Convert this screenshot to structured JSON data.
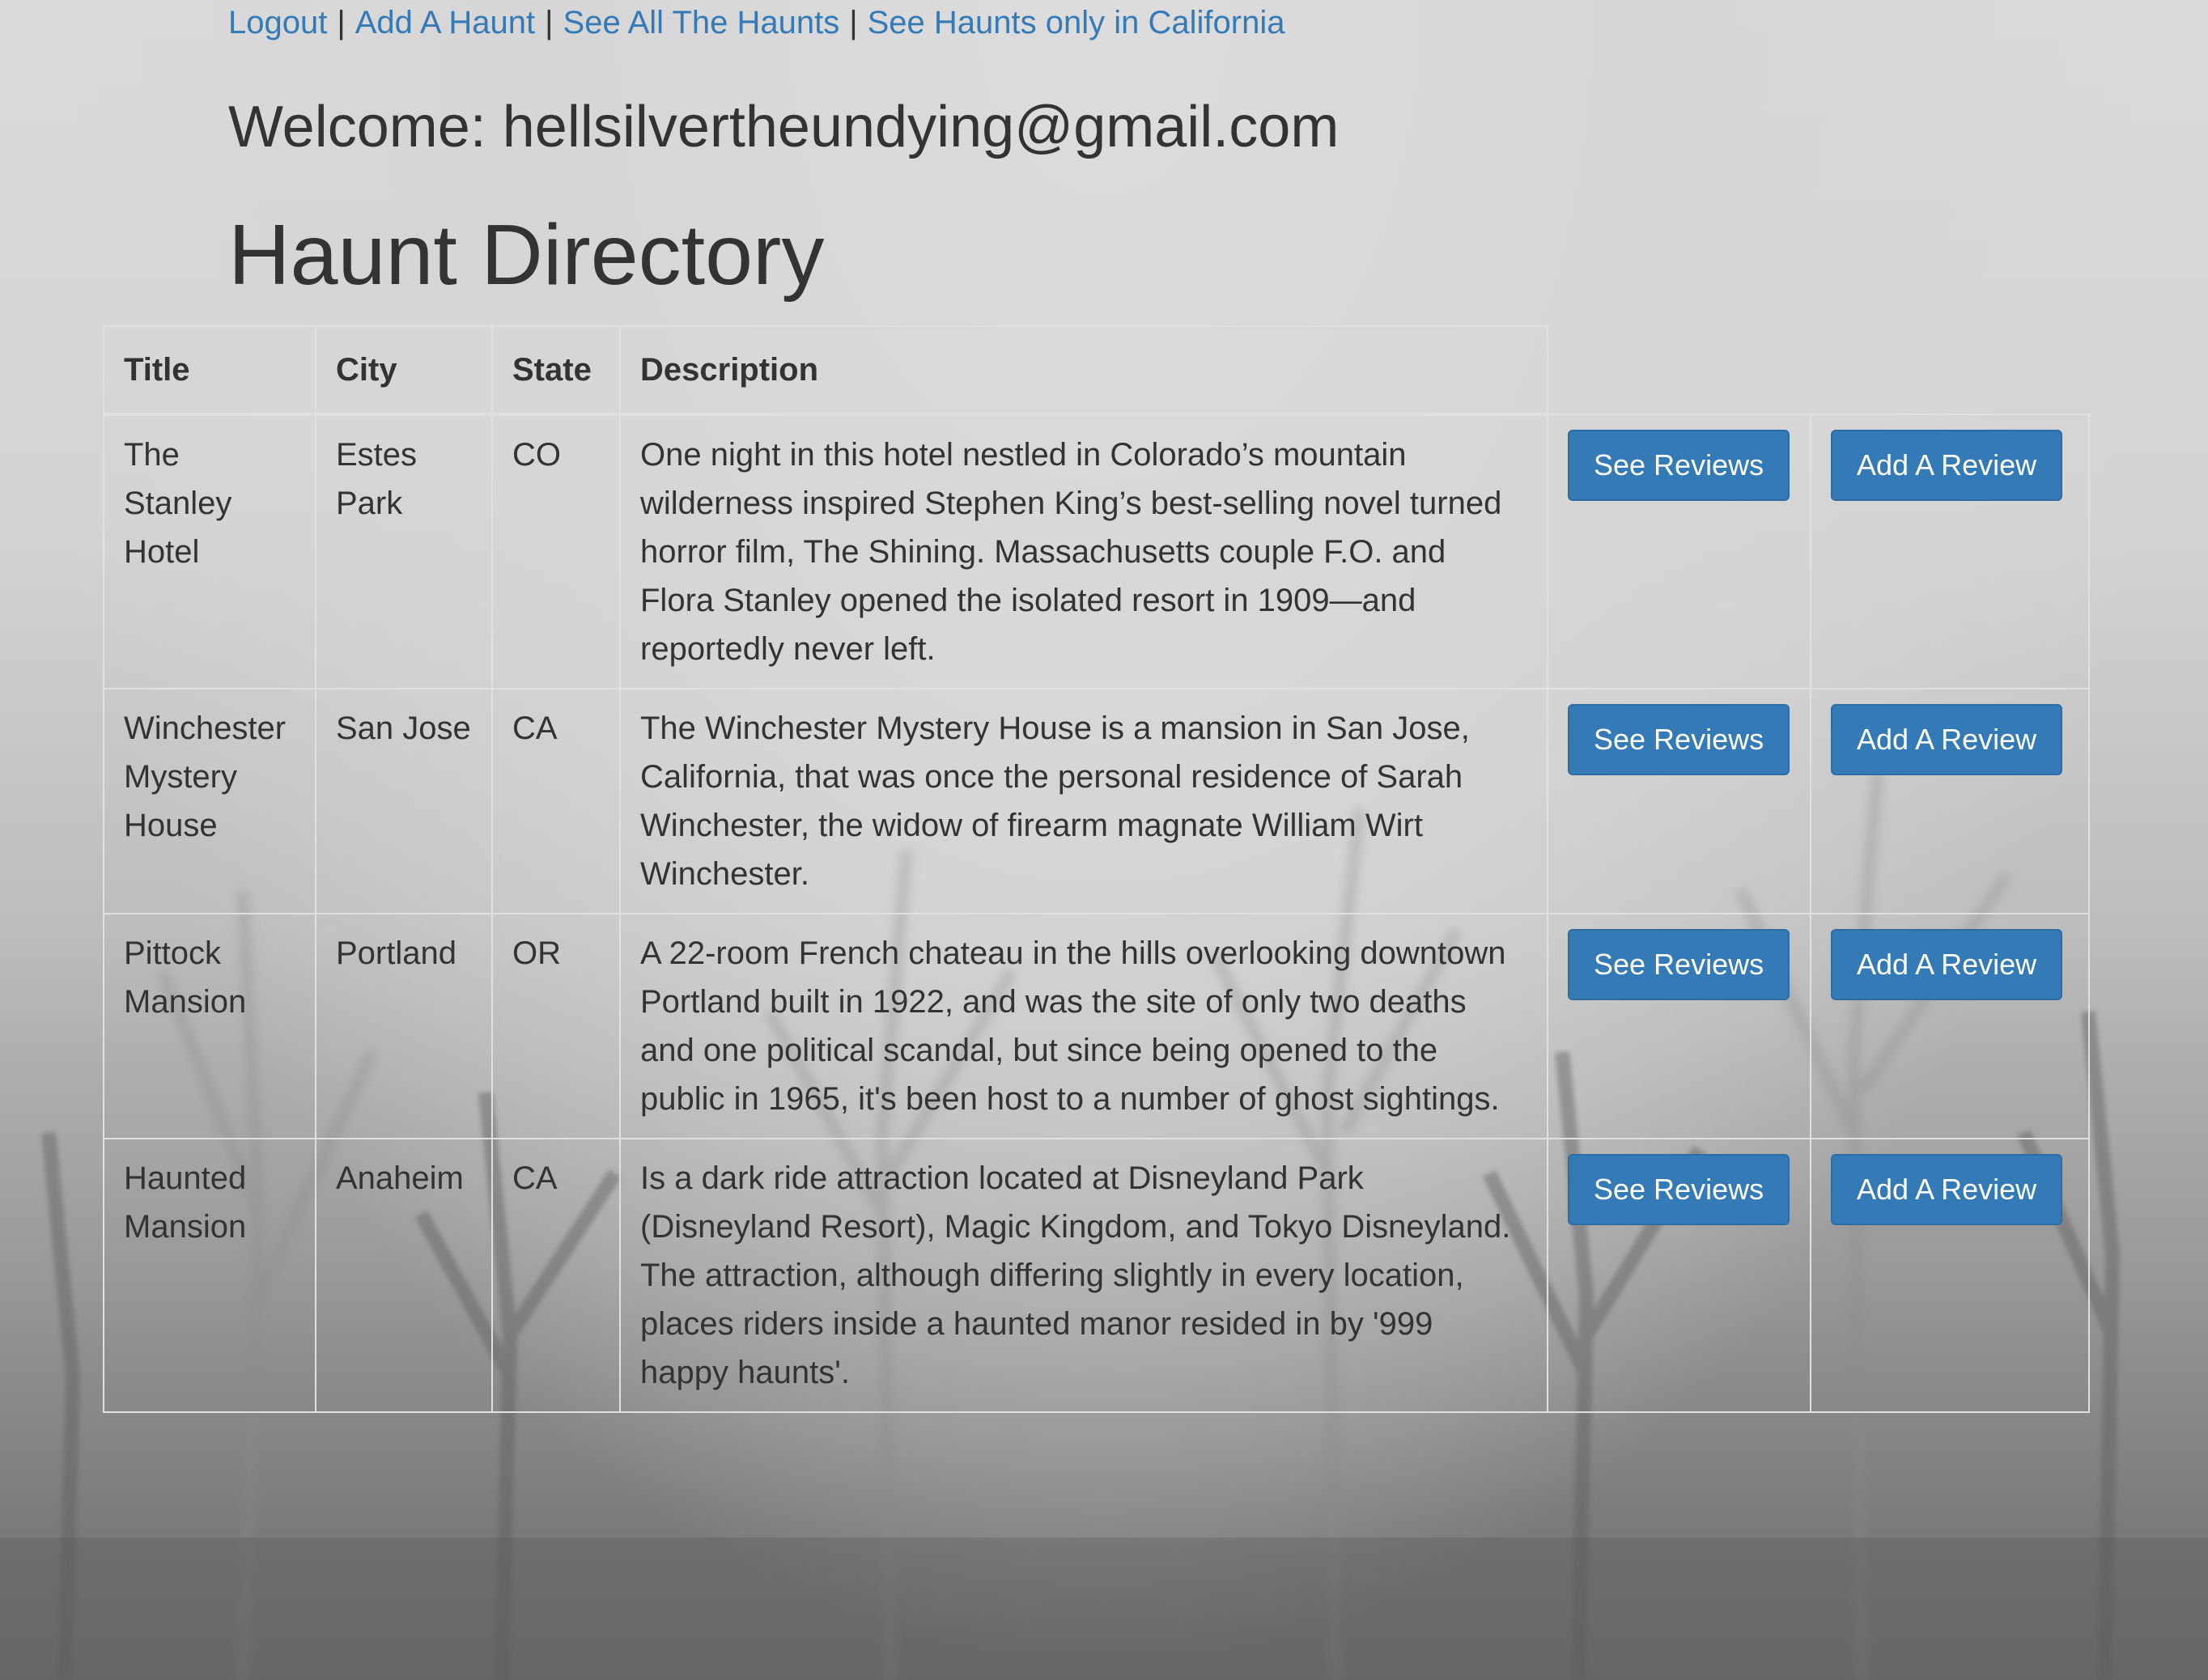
{
  "nav": {
    "links": [
      {
        "label": "Logout"
      },
      {
        "label": "Add A Haunt"
      },
      {
        "label": "See All The Haunts"
      },
      {
        "label": "See Haunts only in California"
      }
    ],
    "separator": "|"
  },
  "welcome": "Welcome: hellsilvertheundying@gmail.com",
  "page_title": "Haunt Directory",
  "table": {
    "headers": [
      "Title",
      "City",
      "State",
      "Description"
    ],
    "rows": [
      {
        "title": "The Stanley Hotel",
        "city": "Estes Park",
        "state": "CO",
        "description": "One night in this hotel nestled in Colorado’s mountain wilderness inspired Stephen King’s best-selling novel turned horror film, The Shining. Massachusetts couple F.O. and Flora Stanley opened the isolated resort in 1909—and reportedly never left.",
        "see_reviews": "See Reviews",
        "add_review": "Add A Review"
      },
      {
        "title": "Winchester Mystery House",
        "city": "San Jose",
        "state": "CA",
        "description": "The Winchester Mystery House is a mansion in San Jose, California, that was once the personal residence of Sarah Winchester, the widow of firearm magnate William Wirt Winchester.",
        "see_reviews": "See Reviews",
        "add_review": "Add A Review"
      },
      {
        "title": "Pittock Mansion",
        "city": "Portland",
        "state": "OR",
        "description": "A 22-room French chateau in the hills overlooking downtown Portland built in 1922, and was the site of only two deaths and one political scandal, but since being opened to the public in 1965, it's been host to a number of ghost sightings.",
        "see_reviews": "See Reviews",
        "add_review": "Add A Review"
      },
      {
        "title": "Haunted Mansion",
        "city": "Anaheim",
        "state": "CA",
        "description": "Is a dark ride attraction located at Disneyland Park (Disneyland Resort), Magic Kingdom, and Tokyo Disneyland. The attraction, although differing slightly in every location, places riders inside a haunted manor resided in by '999 happy haunts'.",
        "see_reviews": "See Reviews",
        "add_review": "Add A Review"
      }
    ]
  },
  "colors": {
    "link": "#337ab7",
    "button_bg": "#337ab7",
    "button_border": "#2e6da4",
    "text": "#333333",
    "table_border": "#e0e0e0"
  }
}
